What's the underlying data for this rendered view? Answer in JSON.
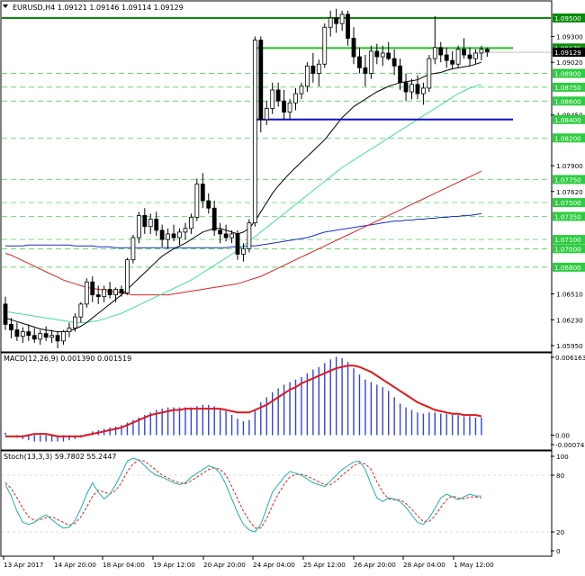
{
  "chart_data": {
    "type": "candlestick",
    "symbol_header": "EURUSD,H4  1.09121 1.09146 1.09114 1.09129",
    "price_scale": [
      1.095,
      1.093,
      1.09175,
      1.09129,
      1.0902,
      1.089,
      1.0875,
      1.086,
      1.0845,
      1.084,
      1.082,
      1.079,
      1.0775,
      1.0762,
      1.075,
      1.0735,
      1.071,
      1.07,
      1.068,
      1.0651,
      1.0623,
      1.0595
    ],
    "price_labels": [
      "1.09500",
      "1.09300",
      "1.09175",
      "1.09129",
      "1.09020",
      "1.08900",
      "1.08750",
      "1.08600",
      "1.08450",
      "1.08400",
      "1.08200",
      "1.07900",
      "1.07750",
      "1.07620",
      "1.07500",
      "1.07350",
      "1.07100",
      "1.07000",
      "1.06800",
      "1.06510",
      "1.06230",
      "1.05950"
    ],
    "highlighted_levels": [
      "1.09500",
      "1.09175",
      "1.09129",
      "1.08900",
      "1.08750",
      "1.08600",
      "1.08400",
      "1.08200",
      "1.07750",
      "1.07500",
      "1.07350",
      "1.07100",
      "1.07000",
      "1.06800"
    ],
    "dashed_levels": [
      1.089,
      1.0875,
      1.086,
      1.082,
      1.0775,
      1.075,
      1.0735,
      1.071,
      1.07,
      1.068
    ],
    "resistance_level": 1.095,
    "range_upper": 1.09175,
    "range_lower": 1.084,
    "current_price": 1.09129,
    "time_labels": [
      "13 Apr 2017",
      "14 Apr 20:00",
      "18 Apr 04:00",
      "19 Apr 12:00",
      "20 Apr 20:00",
      "24 Apr 04:00",
      "25 Apr 12:00",
      "26 Apr 20:00",
      "28 Apr 04:00",
      "1 May 12:00"
    ],
    "candles": [
      [
        1.064,
        1.0648,
        1.0612,
        1.0618
      ],
      [
        1.0618,
        1.0625,
        1.0603,
        1.0612
      ],
      [
        1.0612,
        1.062,
        1.06,
        1.0605
      ],
      [
        1.0605,
        1.0615,
        1.0598,
        1.061
      ],
      [
        1.061,
        1.0618,
        1.06,
        1.0606
      ],
      [
        1.0606,
        1.0614,
        1.0598,
        1.0602
      ],
      [
        1.0602,
        1.0612,
        1.0596,
        1.0608
      ],
      [
        1.0608,
        1.0616,
        1.06,
        1.0604
      ],
      [
        1.0604,
        1.0612,
        1.0598,
        1.0606
      ],
      [
        1.0606,
        1.061,
        1.0592,
        1.06
      ],
      [
        1.06,
        1.0612,
        1.0596,
        1.061
      ],
      [
        1.061,
        1.062,
        1.0604,
        1.0614
      ],
      [
        1.0614,
        1.063,
        1.061,
        1.0626
      ],
      [
        1.0626,
        1.0642,
        1.062,
        1.064
      ],
      [
        1.064,
        1.0668,
        1.0636,
        1.0664
      ],
      [
        1.0664,
        1.067,
        1.0642,
        1.065
      ],
      [
        1.065,
        1.066,
        1.064,
        1.0648
      ],
      [
        1.0648,
        1.066,
        1.0642,
        1.0656
      ],
      [
        1.0656,
        1.0664,
        1.0646,
        1.065
      ],
      [
        1.065,
        1.0658,
        1.0642,
        1.0656
      ],
      [
        1.0656,
        1.066,
        1.0648,
        1.0652
      ],
      [
        1.0652,
        1.069,
        1.065,
        1.0688
      ],
      [
        1.0688,
        1.0715,
        1.0684,
        1.0712
      ],
      [
        1.0712,
        1.074,
        1.0706,
        1.0736
      ],
      [
        1.0736,
        1.0744,
        1.0716,
        1.0724
      ],
      [
        1.0724,
        1.0738,
        1.0716,
        1.0732
      ],
      [
        1.0732,
        1.074,
        1.0714,
        1.072
      ],
      [
        1.072,
        1.0726,
        1.0702,
        1.071
      ],
      [
        1.071,
        1.0722,
        1.07,
        1.0716
      ],
      [
        1.0716,
        1.0726,
        1.0708,
        1.0712
      ],
      [
        1.0712,
        1.0722,
        1.0704,
        1.0718
      ],
      [
        1.0718,
        1.0728,
        1.071,
        1.0722
      ],
      [
        1.0722,
        1.0738,
        1.0716,
        1.0734
      ],
      [
        1.0734,
        1.0776,
        1.073,
        1.077
      ],
      [
        1.077,
        1.0782,
        1.0744,
        1.0752
      ],
      [
        1.0752,
        1.076,
        1.0738,
        1.0744
      ],
      [
        1.0744,
        1.0752,
        1.0714,
        1.072
      ],
      [
        1.072,
        1.0728,
        1.0706,
        1.0716
      ],
      [
        1.0716,
        1.0726,
        1.0708,
        1.0712
      ],
      [
        1.0712,
        1.072,
        1.0706,
        1.0716
      ],
      [
        1.0716,
        1.072,
        1.0688,
        1.0694
      ],
      [
        1.0694,
        1.0706,
        1.0686,
        1.07
      ],
      [
        1.07,
        1.0732,
        1.0696,
        1.0728
      ],
      [
        1.0728,
        1.093,
        1.0724,
        1.0926
      ],
      [
        1.0926,
        1.093,
        1.0826,
        1.084
      ],
      [
        1.084,
        1.086,
        1.0834,
        1.0852
      ],
      [
        1.0852,
        1.088,
        1.0846,
        1.0872
      ],
      [
        1.0872,
        1.088,
        1.0854,
        1.086
      ],
      [
        1.086,
        1.0872,
        1.084,
        1.0848
      ],
      [
        1.0848,
        1.0862,
        1.084,
        1.0858
      ],
      [
        1.0858,
        1.0874,
        1.085,
        1.0868
      ],
      [
        1.0868,
        1.088,
        1.0862,
        1.0876
      ],
      [
        1.0876,
        1.0902,
        1.087,
        1.0898
      ],
      [
        1.0898,
        1.0912,
        1.088,
        1.089
      ],
      [
        1.089,
        1.0905,
        1.0876,
        1.09
      ],
      [
        1.09,
        1.0944,
        1.0896,
        1.094
      ],
      [
        1.094,
        1.0958,
        1.093,
        1.095
      ],
      [
        1.095,
        1.096,
        1.0934,
        1.0944
      ],
      [
        1.0944,
        1.0958,
        1.0936,
        1.0954
      ],
      [
        1.0954,
        1.0958,
        1.092,
        1.0928
      ],
      [
        1.0928,
        1.094,
        1.09,
        1.0908
      ],
      [
        1.0908,
        1.0918,
        1.089,
        1.0896
      ],
      [
        1.0896,
        1.091,
        1.0876,
        1.089
      ],
      [
        1.089,
        1.092,
        1.0884,
        1.0914
      ],
      [
        1.0914,
        1.0922,
        1.09,
        1.0908
      ],
      [
        1.0908,
        1.092,
        1.0898,
        1.0912
      ],
      [
        1.0912,
        1.0924,
        1.0904,
        1.0906
      ],
      [
        1.0906,
        1.0916,
        1.0888,
        1.0898
      ],
      [
        1.0898,
        1.0906,
        1.0872,
        1.088
      ],
      [
        1.088,
        1.089,
        1.086,
        1.087
      ],
      [
        1.087,
        1.0884,
        1.0862,
        1.0878
      ],
      [
        1.0878,
        1.0888,
        1.0862,
        1.0868
      ],
      [
        1.0868,
        1.088,
        1.0856,
        1.0874
      ],
      [
        1.0874,
        1.091,
        1.087,
        1.0906
      ],
      [
        1.0906,
        1.0952,
        1.09,
        1.0918
      ],
      [
        1.0918,
        1.0924,
        1.0902,
        1.091
      ],
      [
        1.091,
        1.0918,
        1.0896,
        1.0904
      ],
      [
        1.0904,
        1.0914,
        1.0894,
        1.09
      ],
      [
        1.09,
        1.092,
        1.0896,
        1.0916
      ],
      [
        1.0916,
        1.0928,
        1.0906,
        1.091
      ],
      [
        1.091,
        1.0918,
        1.0898,
        1.0906
      ],
      [
        1.0906,
        1.0916,
        1.09,
        1.0912
      ],
      [
        1.0912,
        1.092,
        1.0904,
        1.0916
      ],
      [
        1.0916,
        1.0918,
        1.0908,
        1.0913
      ]
    ],
    "ma_black": [
      1.0625,
      1.0623,
      1.0621,
      1.0619,
      1.0617,
      1.0615,
      1.0613,
      1.0612,
      1.0611,
      1.061,
      1.061,
      1.0611,
      1.0613,
      1.0616,
      1.062,
      1.0625,
      1.063,
      1.0635,
      1.064,
      1.0645,
      1.065,
      1.0656,
      1.0662,
      1.0668,
      1.0674,
      1.068,
      1.0686,
      1.0692,
      1.0696,
      1.07,
      1.0703,
      1.0706,
      1.071,
      1.0714,
      1.0718,
      1.072,
      1.0722,
      1.0722,
      1.072,
      1.0718,
      1.0716,
      1.0718,
      1.0722,
      1.073,
      1.074,
      1.075,
      1.076,
      1.0768,
      1.0775,
      1.0782,
      1.0788,
      1.0794,
      1.08,
      1.0806,
      1.0812,
      1.0818,
      1.0826,
      1.0834,
      1.0842,
      1.0848,
      1.0854,
      1.0858,
      1.0862,
      1.0866,
      1.087,
      1.0873,
      1.0876,
      1.0878,
      1.088,
      1.0881,
      1.0882,
      1.0883,
      1.0886,
      1.0889,
      1.089,
      1.0891,
      1.0893,
      1.0895,
      1.0896,
      1.0897,
      1.0898,
      1.09,
      1.0902
    ],
    "ma_green": [
      1.0632,
      1.0631,
      1.063,
      1.0629,
      1.0628,
      1.0627,
      1.0626,
      1.0625,
      1.0624,
      1.0623,
      1.0622,
      1.0621,
      1.062,
      1.062,
      1.062,
      1.0621,
      1.0622,
      1.0624,
      1.0626,
      1.0628,
      1.063,
      1.0633,
      1.0636,
      1.0639,
      1.0642,
      1.0645,
      1.0648,
      1.0651,
      1.0654,
      1.0657,
      1.066,
      1.0663,
      1.0666,
      1.067,
      1.0674,
      1.0678,
      1.0682,
      1.0686,
      1.069,
      1.0694,
      1.0698,
      1.0703,
      1.0708,
      1.0713,
      1.0718,
      1.0723,
      1.0728,
      1.0733,
      1.0738,
      1.0743,
      1.0748,
      1.0753,
      1.0758,
      1.0763,
      1.0768,
      1.0773,
      1.0778,
      1.0783,
      1.0788,
      1.0792,
      1.0796,
      1.08,
      1.0804,
      1.0808,
      1.0812,
      1.0816,
      1.082,
      1.0824,
      1.0828,
      1.0832,
      1.0836,
      1.084,
      1.0844,
      1.0848,
      1.0852,
      1.0856,
      1.086,
      1.0864,
      1.0868,
      1.0871,
      1.0874,
      1.0876,
      1.0878
    ],
    "ma_red": [
      1.0695,
      1.0693,
      1.069,
      1.0687,
      1.0684,
      1.0681,
      1.0678,
      1.0675,
      1.0672,
      1.0669,
      1.0666,
      1.0664,
      1.0662,
      1.066,
      1.0658,
      1.0657,
      1.0656,
      1.0655,
      1.0654,
      1.0653,
      1.0652,
      1.0651,
      1.065,
      1.065,
      1.065,
      1.065,
      1.065,
      1.065,
      1.065,
      1.0651,
      1.0652,
      1.0653,
      1.0654,
      1.0655,
      1.0656,
      1.0657,
      1.0658,
      1.0659,
      1.066,
      1.0661,
      1.0662,
      1.0664,
      1.0666,
      1.0668,
      1.067,
      1.0673,
      1.0676,
      1.0679,
      1.0682,
      1.0685,
      1.0688,
      1.0691,
      1.0694,
      1.0697,
      1.07,
      1.0703,
      1.0706,
      1.0709,
      1.0712,
      1.0715,
      1.0718,
      1.0721,
      1.0724,
      1.0727,
      1.073,
      1.0733,
      1.0736,
      1.0739,
      1.0742,
      1.0745,
      1.0748,
      1.0751,
      1.0754,
      1.0757,
      1.076,
      1.0763,
      1.0766,
      1.0769,
      1.0772,
      1.0775,
      1.0778,
      1.0781,
      1.0784
    ],
    "ma_blue": [
      1.0703,
      1.0703,
      1.0703,
      1.0703,
      1.0704,
      1.0704,
      1.0704,
      1.0704,
      1.0704,
      1.0704,
      1.0704,
      1.0704,
      1.0703,
      1.0703,
      1.0703,
      1.0703,
      1.0702,
      1.0702,
      1.0702,
      1.0701,
      1.0701,
      1.0701,
      1.0701,
      1.0701,
      1.0701,
      1.0701,
      1.0701,
      1.0701,
      1.0701,
      1.0701,
      1.0701,
      1.0701,
      1.0701,
      1.0701,
      1.0701,
      1.0701,
      1.0701,
      1.0701,
      1.0701,
      1.0702,
      1.0702,
      1.0702,
      1.0703,
      1.0703,
      1.0704,
      1.0705,
      1.0706,
      1.0707,
      1.0708,
      1.0709,
      1.071,
      1.0711,
      1.0712,
      1.0714,
      1.0716,
      1.0718,
      1.0719,
      1.072,
      1.0721,
      1.0722,
      1.0723,
      1.0724,
      1.0725,
      1.0726,
      1.0727,
      1.0728,
      1.0729,
      1.073,
      1.073,
      1.0731,
      1.0731,
      1.0732,
      1.0732,
      1.0733,
      1.0733,
      1.0734,
      1.0734,
      1.0735,
      1.0735,
      1.0736,
      1.0736,
      1.0737,
      1.0738
    ],
    "macd": {
      "title": "MACD(12,26,9) 0.001390 0.001519",
      "scale_labels": [
        "0.006163",
        "0.00",
        "-0.000745"
      ],
      "max": 0.006163,
      "min": -0.000745,
      "histogram": [
        0.0002,
        0.0,
        -0.0002,
        -0.0003,
        -0.0004,
        -0.0005,
        -0.0005,
        -0.0005,
        -0.0005,
        -0.0005,
        -0.0005,
        -0.0004,
        -0.0003,
        -0.0002,
        0.0001,
        0.0003,
        0.0004,
        0.0005,
        0.0006,
        0.0007,
        0.0008,
        0.001,
        0.0012,
        0.0014,
        0.0016,
        0.0018,
        0.002,
        0.0021,
        0.0022,
        0.0022,
        0.0022,
        0.0022,
        0.0022,
        0.0023,
        0.0024,
        0.0024,
        0.0023,
        0.0021,
        0.0019,
        0.0016,
        0.0013,
        0.0011,
        0.0012,
        0.002,
        0.0026,
        0.003,
        0.0034,
        0.0037,
        0.004,
        0.0042,
        0.0044,
        0.0046,
        0.0049,
        0.0052,
        0.0054,
        0.0057,
        0.006,
        0.0062,
        0.0061,
        0.0058,
        0.0053,
        0.0048,
        0.0044,
        0.0042,
        0.004,
        0.0038,
        0.0035,
        0.003,
        0.0025,
        0.0022,
        0.002,
        0.0018,
        0.0017,
        0.0018,
        0.0018,
        0.0017,
        0.0017,
        0.0016,
        0.0016,
        0.0015,
        0.0015,
        0.0014,
        0.0014
      ],
      "signal": [
        -0.0001,
        -0.0001,
        -0.0001,
        -0.0001,
        0.0,
        0.0001,
        0.0001,
        0.0001,
        0.0,
        -0.0001,
        -0.0001,
        -0.0001,
        -0.0001,
        -0.0001,
        0.0,
        0.0001,
        0.0002,
        0.0003,
        0.0004,
        0.0005,
        0.0006,
        0.0008,
        0.001,
        0.0012,
        0.0014,
        0.0016,
        0.0017,
        0.0018,
        0.0019,
        0.002,
        0.002,
        0.0021,
        0.0021,
        0.0021,
        0.0021,
        0.0021,
        0.0021,
        0.0021,
        0.002,
        0.0019,
        0.0018,
        0.0018,
        0.0018,
        0.002,
        0.0022,
        0.0024,
        0.0027,
        0.003,
        0.0033,
        0.0036,
        0.0038,
        0.0041,
        0.0043,
        0.0045,
        0.0047,
        0.0049,
        0.0051,
        0.0053,
        0.0054,
        0.0055,
        0.0055,
        0.0054,
        0.0052,
        0.005,
        0.0047,
        0.0044,
        0.0041,
        0.0038,
        0.0035,
        0.0032,
        0.0029,
        0.0026,
        0.0024,
        0.0022,
        0.002,
        0.0019,
        0.0018,
        0.0017,
        0.0017,
        0.0016,
        0.0016,
        0.0016,
        0.0015
      ]
    },
    "stoch": {
      "title": "Stoch(13,3,3) 59.7802 55.2447",
      "scale_labels": [
        "100",
        "80",
        "20",
        "0"
      ],
      "main": [
        70,
        58,
        42,
        30,
        28,
        30,
        35,
        38,
        33,
        28,
        24,
        25,
        32,
        45,
        60,
        72,
        62,
        55,
        60,
        70,
        82,
        95,
        98,
        96,
        90,
        84,
        80,
        78,
        75,
        72,
        70,
        72,
        78,
        82,
        86,
        90,
        88,
        82,
        70,
        55,
        40,
        28,
        22,
        20,
        28,
        45,
        62,
        70,
        78,
        84,
        82,
        80,
        76,
        72,
        70,
        68,
        74,
        80,
        86,
        90,
        94,
        95,
        86,
        70,
        56,
        52,
        56,
        55,
        52,
        46,
        38,
        30,
        28,
        35,
        45,
        56,
        60,
        57,
        54,
        57,
        60,
        58,
        58
      ],
      "signal": [
        72,
        66,
        56,
        45,
        36,
        32,
        33,
        35,
        36,
        33,
        30,
        27,
        29,
        36,
        46,
        58,
        64,
        62,
        60,
        64,
        72,
        84,
        92,
        96,
        95,
        90,
        85,
        80,
        77,
        74,
        72,
        71,
        74,
        78,
        82,
        86,
        88,
        86,
        80,
        68,
        55,
        42,
        32,
        24,
        24,
        34,
        48,
        60,
        70,
        78,
        81,
        81,
        79,
        76,
        73,
        70,
        70,
        74,
        80,
        85,
        90,
        93,
        92,
        86,
        73,
        62,
        55,
        54,
        54,
        50,
        44,
        37,
        31,
        31,
        37,
        46,
        54,
        58,
        56,
        55,
        57,
        57,
        56
      ]
    }
  }
}
